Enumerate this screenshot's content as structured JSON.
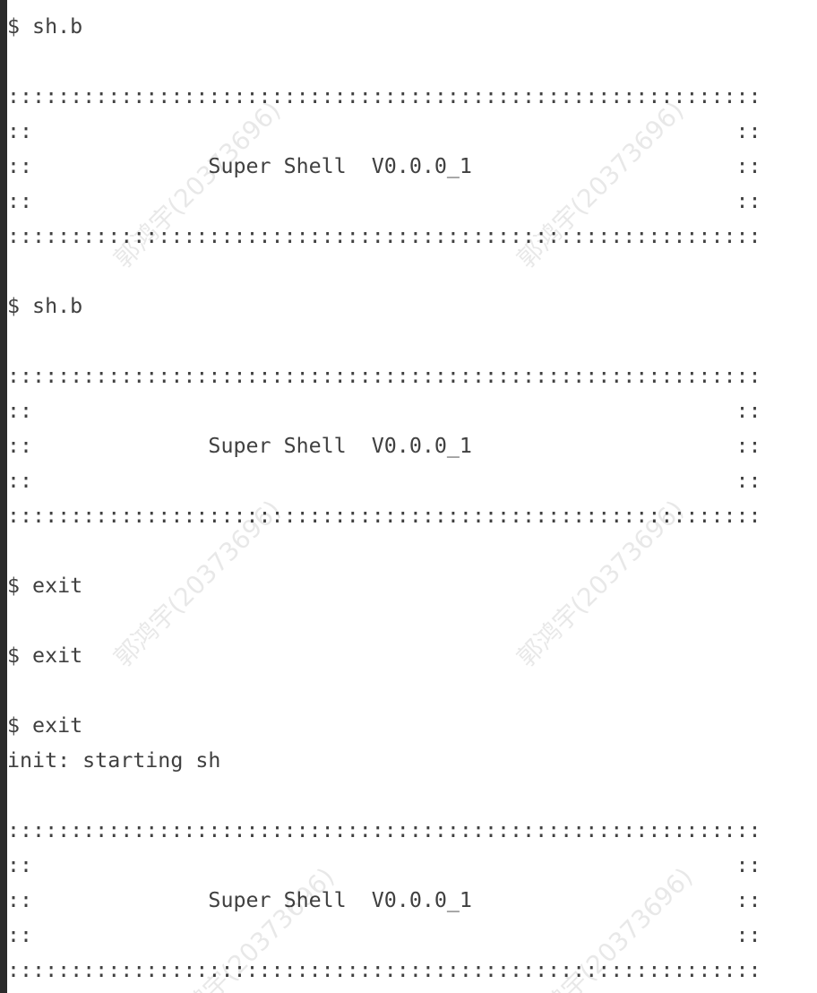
{
  "terminal": {
    "lines": [
      "$ sh.b",
      "",
      "::::::::::::::::::::::::::::::::::::::::::::::::::::::::::::",
      "::                                                        ::",
      "::              Super Shell  V0.0.0_1                     ::",
      "::                                                        ::",
      "::::::::::::::::::::::::::::::::::::::::::::::::::::::::::::",
      "",
      "$ sh.b",
      "",
      "::::::::::::::::::::::::::::::::::::::::::::::::::::::::::::",
      "::                                                        ::",
      "::              Super Shell  V0.0.0_1                     ::",
      "::                                                        ::",
      "::::::::::::::::::::::::::::::::::::::::::::::::::::::::::::",
      "",
      "$ exit",
      "",
      "$ exit",
      "",
      "$ exit",
      "init: starting sh",
      "",
      "::::::::::::::::::::::::::::::::::::::::::::::::::::::::::::",
      "::                                                        ::",
      "::              Super Shell  V0.0.0_1                     ::",
      "::                                                        ::",
      "::::::::::::::::::::::::::::::::::::::::::::::::::::::::::::"
    ]
  },
  "watermark": {
    "text": "郭鸿宇(20373696)"
  },
  "colors": {
    "text": "#404040",
    "background": "#ffffff",
    "left_rule": "#2b2b2b"
  }
}
